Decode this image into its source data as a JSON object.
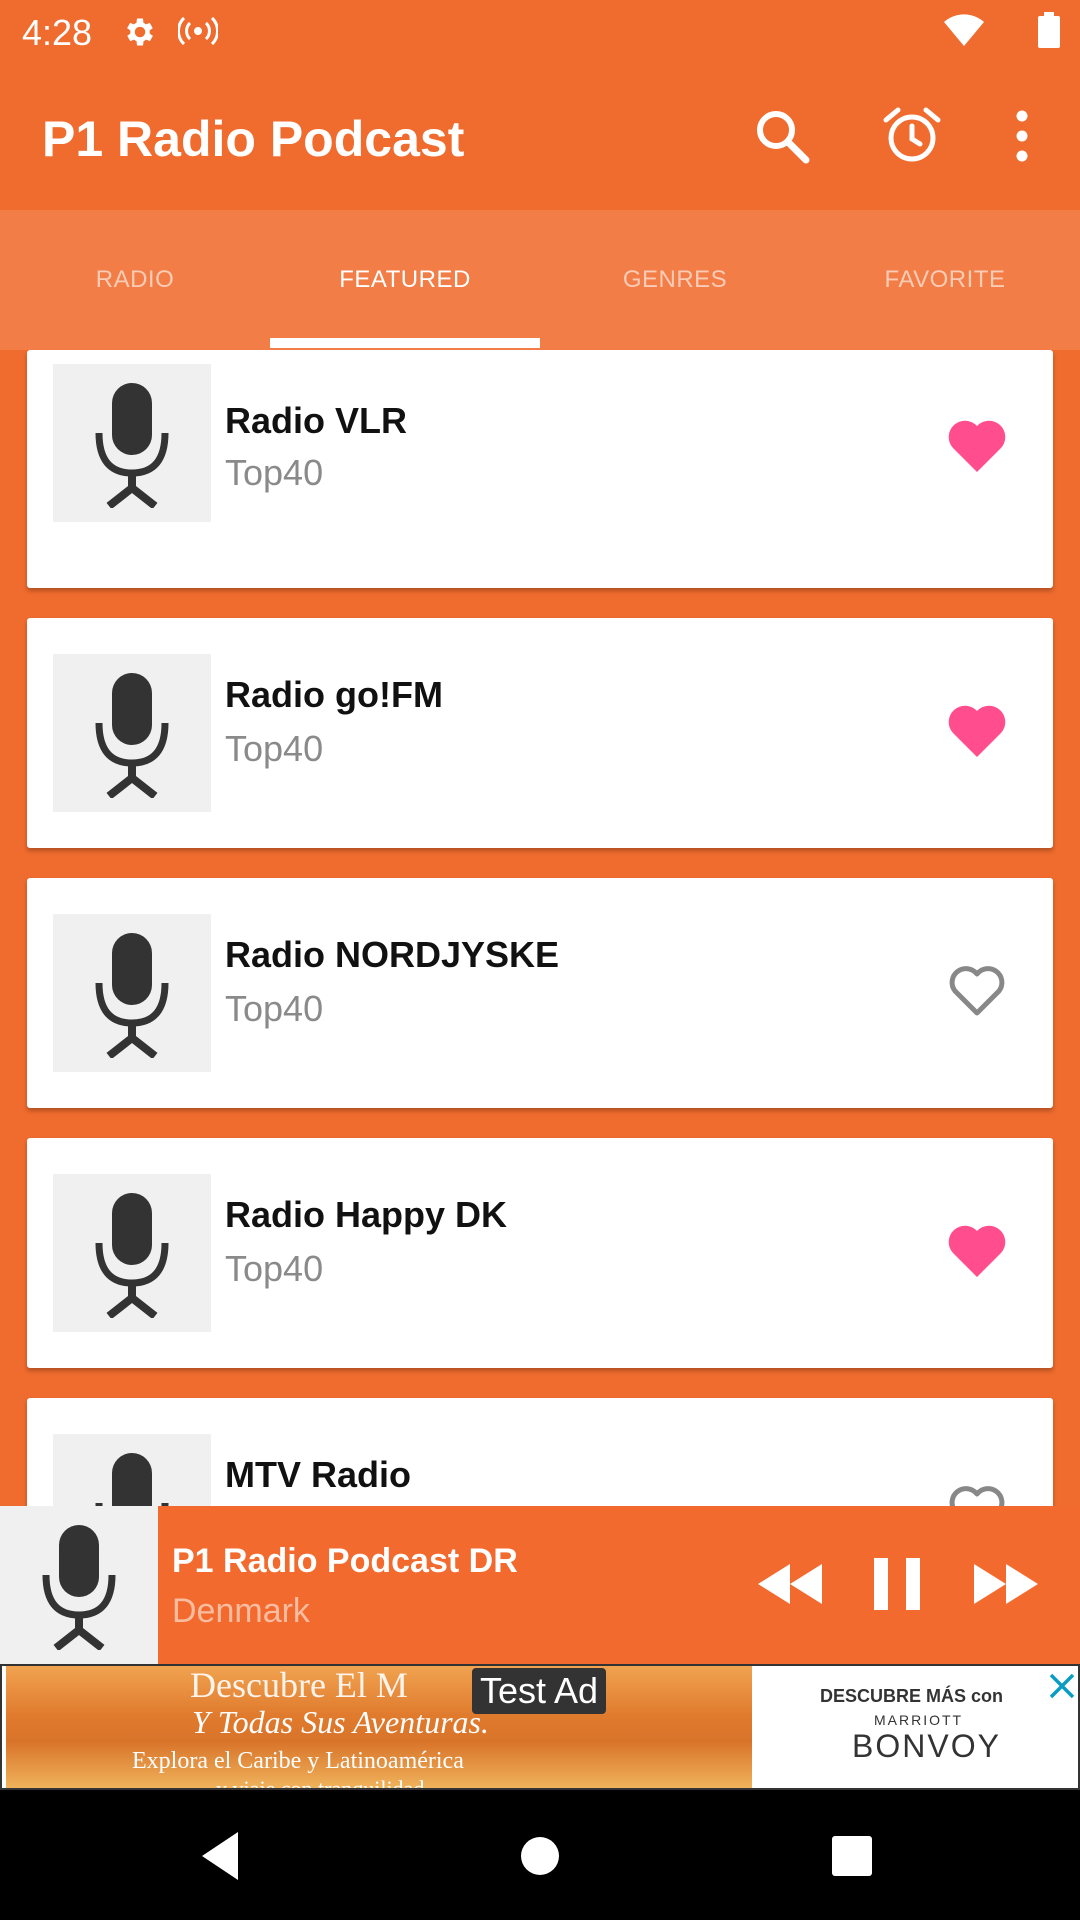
{
  "status_bar": {
    "time": "4:28",
    "icons": [
      "gear-icon",
      "broadcast-icon",
      "wifi-icon",
      "battery-icon"
    ]
  },
  "app_bar": {
    "title": "P1 Radio Podcast",
    "actions": [
      "search-icon",
      "alarm-icon",
      "more-vert-icon"
    ]
  },
  "tabs": [
    {
      "label": "RADIO",
      "active": false
    },
    {
      "label": "FEATURED",
      "active": true
    },
    {
      "label": "GENRES",
      "active": false
    },
    {
      "label": "FAVORITE",
      "active": false
    }
  ],
  "stations": [
    {
      "name": "Radio VLR",
      "genre": "Top40",
      "favorite": true
    },
    {
      "name": "Radio go!FM",
      "genre": "Top40",
      "favorite": true
    },
    {
      "name": "Radio NORDJYSKE",
      "genre": "Top40",
      "favorite": false
    },
    {
      "name": "Radio Happy DK",
      "genre": "Top40",
      "favorite": true
    },
    {
      "name": "MTV Radio",
      "genre": "",
      "favorite": false
    }
  ],
  "player": {
    "title": "P1 Radio Podcast DR",
    "subtitle": "Denmark",
    "controls": [
      "rewind-icon",
      "pause-icon",
      "fast-forward-icon"
    ]
  },
  "ad": {
    "label": "Test Ad",
    "line1": "Descubre El M",
    "line2": "Y Todas Sus Aventuras.",
    "line3": "Explora el Caribe y Latinoamérica",
    "line4": "y viaje con tranquilidad",
    "brand_line1": "DESCUBRE MÁS con",
    "brand_line2": "MARRIOTT",
    "brand_line3": "BONVOY"
  },
  "colors": {
    "primary": "#ef6b2e",
    "tab_bar": "#f27d47",
    "heart_filled": "#ff4d8d",
    "heart_outline": "#888888"
  }
}
